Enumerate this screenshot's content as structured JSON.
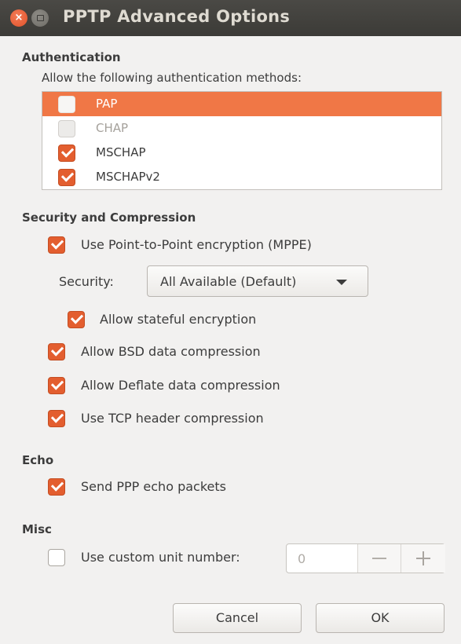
{
  "window": {
    "title": "PPTP Advanced Options"
  },
  "authentication": {
    "heading": "Authentication",
    "intro": "Allow the following authentication methods:",
    "methods": [
      {
        "label": "PAP",
        "checked": false,
        "selected": true,
        "enabled": true
      },
      {
        "label": "CHAP",
        "checked": false,
        "selected": false,
        "enabled": false
      },
      {
        "label": "MSCHAP",
        "checked": true,
        "selected": false,
        "enabled": true
      },
      {
        "label": "MSCHAPv2",
        "checked": true,
        "selected": false,
        "enabled": true
      }
    ]
  },
  "security": {
    "heading": "Security and Compression",
    "mppe_label": "Use Point-to-Point encryption (MPPE)",
    "mppe_checked": true,
    "security_label": "Security:",
    "security_value": "All Available (Default)",
    "stateful_label": "Allow stateful encryption",
    "stateful_checked": true,
    "bsd_label": "Allow BSD data compression",
    "bsd_checked": true,
    "deflate_label": "Allow Deflate data compression",
    "deflate_checked": true,
    "tcp_label": "Use TCP header compression",
    "tcp_checked": true
  },
  "echo": {
    "heading": "Echo",
    "send_label": "Send PPP echo packets",
    "send_checked": true
  },
  "misc": {
    "heading": "Misc",
    "unit_label": "Use custom unit number:",
    "unit_checked": false,
    "unit_value": "0"
  },
  "buttons": {
    "cancel": "Cancel",
    "ok": "OK"
  },
  "colors": {
    "accent": "#e35e2f",
    "selection": "#f07746",
    "titlebar": "#3c3b37"
  },
  "icons": {
    "close": "close-icon",
    "minimize": "minimize-icon"
  }
}
